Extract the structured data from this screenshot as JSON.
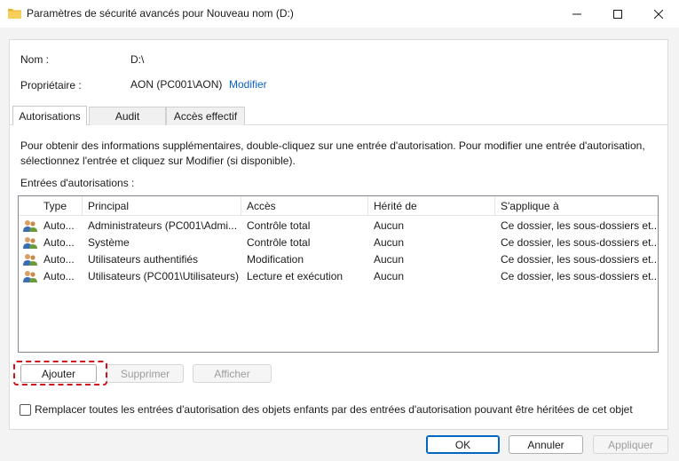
{
  "window": {
    "title": "Paramètres de sécurité avancés pour Nouveau nom (D:)",
    "controls": {
      "minimize": "minimize-icon",
      "maximize": "maximize-icon",
      "close": "close-icon"
    }
  },
  "info": {
    "name_label": "Nom :",
    "name_value": "D:\\",
    "owner_label": "Propriétaire :",
    "owner_value": "AON (PC001\\AON)",
    "owner_link": "Modifier"
  },
  "tabs": [
    {
      "label": "Autorisations",
      "active": true
    },
    {
      "label": "Audit",
      "active": false
    },
    {
      "label": "Accès effectif",
      "active": false
    }
  ],
  "description": {
    "line1": "Pour obtenir des informations supplémentaires, double-cliquez sur une entrée d'autorisation. Pour modifier une entrée d'autorisation,",
    "line2": "sélectionnez l'entrée et cliquez sur Modifier (si disponible)."
  },
  "entries_label": "Entrées d'autorisations :",
  "table": {
    "columns": [
      "Type",
      "Principal",
      "Accès",
      "Hérité de",
      "S'applique à"
    ],
    "rows": [
      [
        "Auto...",
        "Administrateurs (PC001\\Admi...",
        "Contrôle total",
        "Aucun",
        "Ce dossier, les sous-dossiers et..."
      ],
      [
        "Auto...",
        "Système",
        "Contrôle total",
        "Aucun",
        "Ce dossier, les sous-dossiers et..."
      ],
      [
        "Auto...",
        "Utilisateurs authentifiés",
        "Modification",
        "Aucun",
        "Ce dossier, les sous-dossiers et..."
      ],
      [
        "Auto...",
        "Utilisateurs (PC001\\Utilisateurs)",
        "Lecture et exécution",
        "Aucun",
        "Ce dossier, les sous-dossiers et..."
      ]
    ]
  },
  "actions": {
    "add": "Ajouter",
    "remove": "Supprimer",
    "view": "Afficher"
  },
  "replace_checkbox": {
    "label": "Remplacer toutes les entrées d'autorisation des objets enfants par des entrées d'autorisation pouvant être héritées de cet objet",
    "checked": false
  },
  "footer": {
    "ok": "OK",
    "cancel": "Annuler",
    "apply": "Appliquer"
  },
  "colors": {
    "link": "#0a63c9",
    "highlight": "#d0101a",
    "primary_border": "#0067c0"
  }
}
